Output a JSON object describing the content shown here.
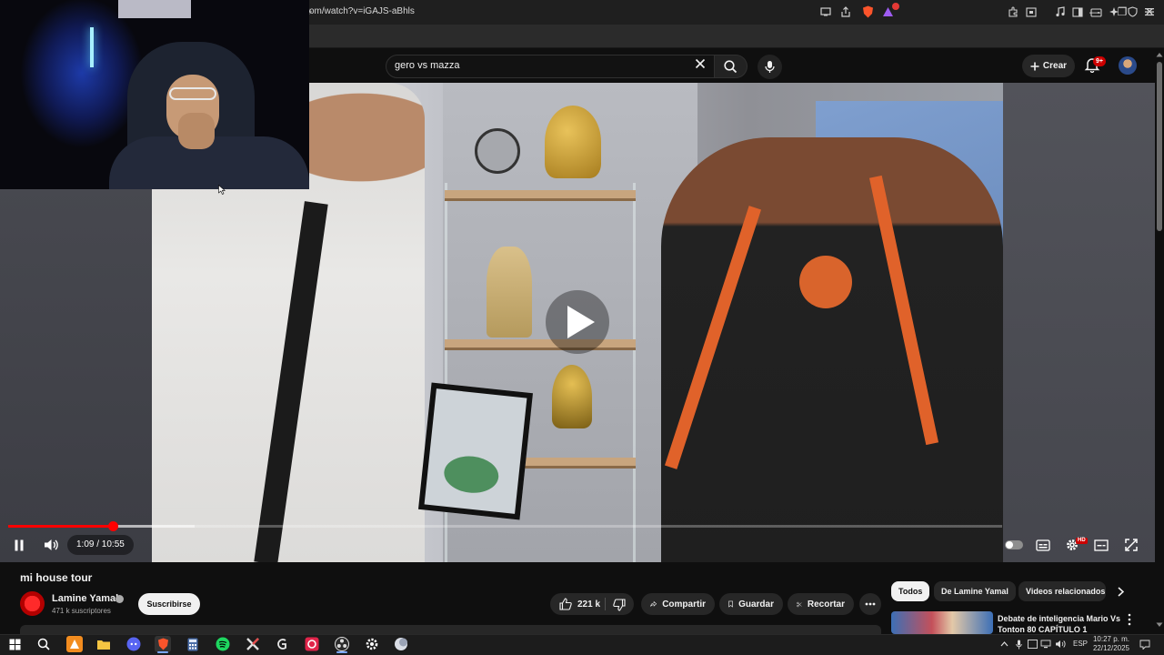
{
  "browser": {
    "url": "om/watch?v=iGAJS-aBhls",
    "new_tab": "+",
    "brave_shields_count": "1",
    "window_controls": {
      "minimize": "—",
      "restore": "❐",
      "close": "✕"
    }
  },
  "masthead": {
    "search_query": "gero vs mazza",
    "create_label": "Crear",
    "notifications_badge": "9+"
  },
  "player": {
    "time_display": "1:09 / 10:55",
    "progress": 0.105,
    "buffered": 0.188,
    "quality_badge": "HD",
    "state": "paused"
  },
  "video": {
    "title": "mi house tour",
    "channel_name": "Lamine Yamal",
    "subscribers": "471 k suscriptores",
    "subscribe_label": "Suscribirse",
    "likes": "221 k",
    "share_label": "Compartir",
    "save_label": "Guardar",
    "clip_label": "Recortar"
  },
  "related": {
    "chips": [
      {
        "label": "Todos",
        "active": true
      },
      {
        "label": "De Lamine Yamal",
        "active": false
      },
      {
        "label": "Videos relacionados",
        "active": false
      }
    ],
    "first_video_title": "Debate de inteligencia Mario Vs Tonton 80 CAPÍTULO 1"
  },
  "taskbar": {
    "language": "ESP",
    "time": "10:27 p. m.",
    "date": "22/12/2025"
  },
  "colors": {
    "youtube_red": "#ff0000",
    "background": "#0f0f0f",
    "chip_bg": "#272727",
    "text": "#f1f1f1"
  }
}
